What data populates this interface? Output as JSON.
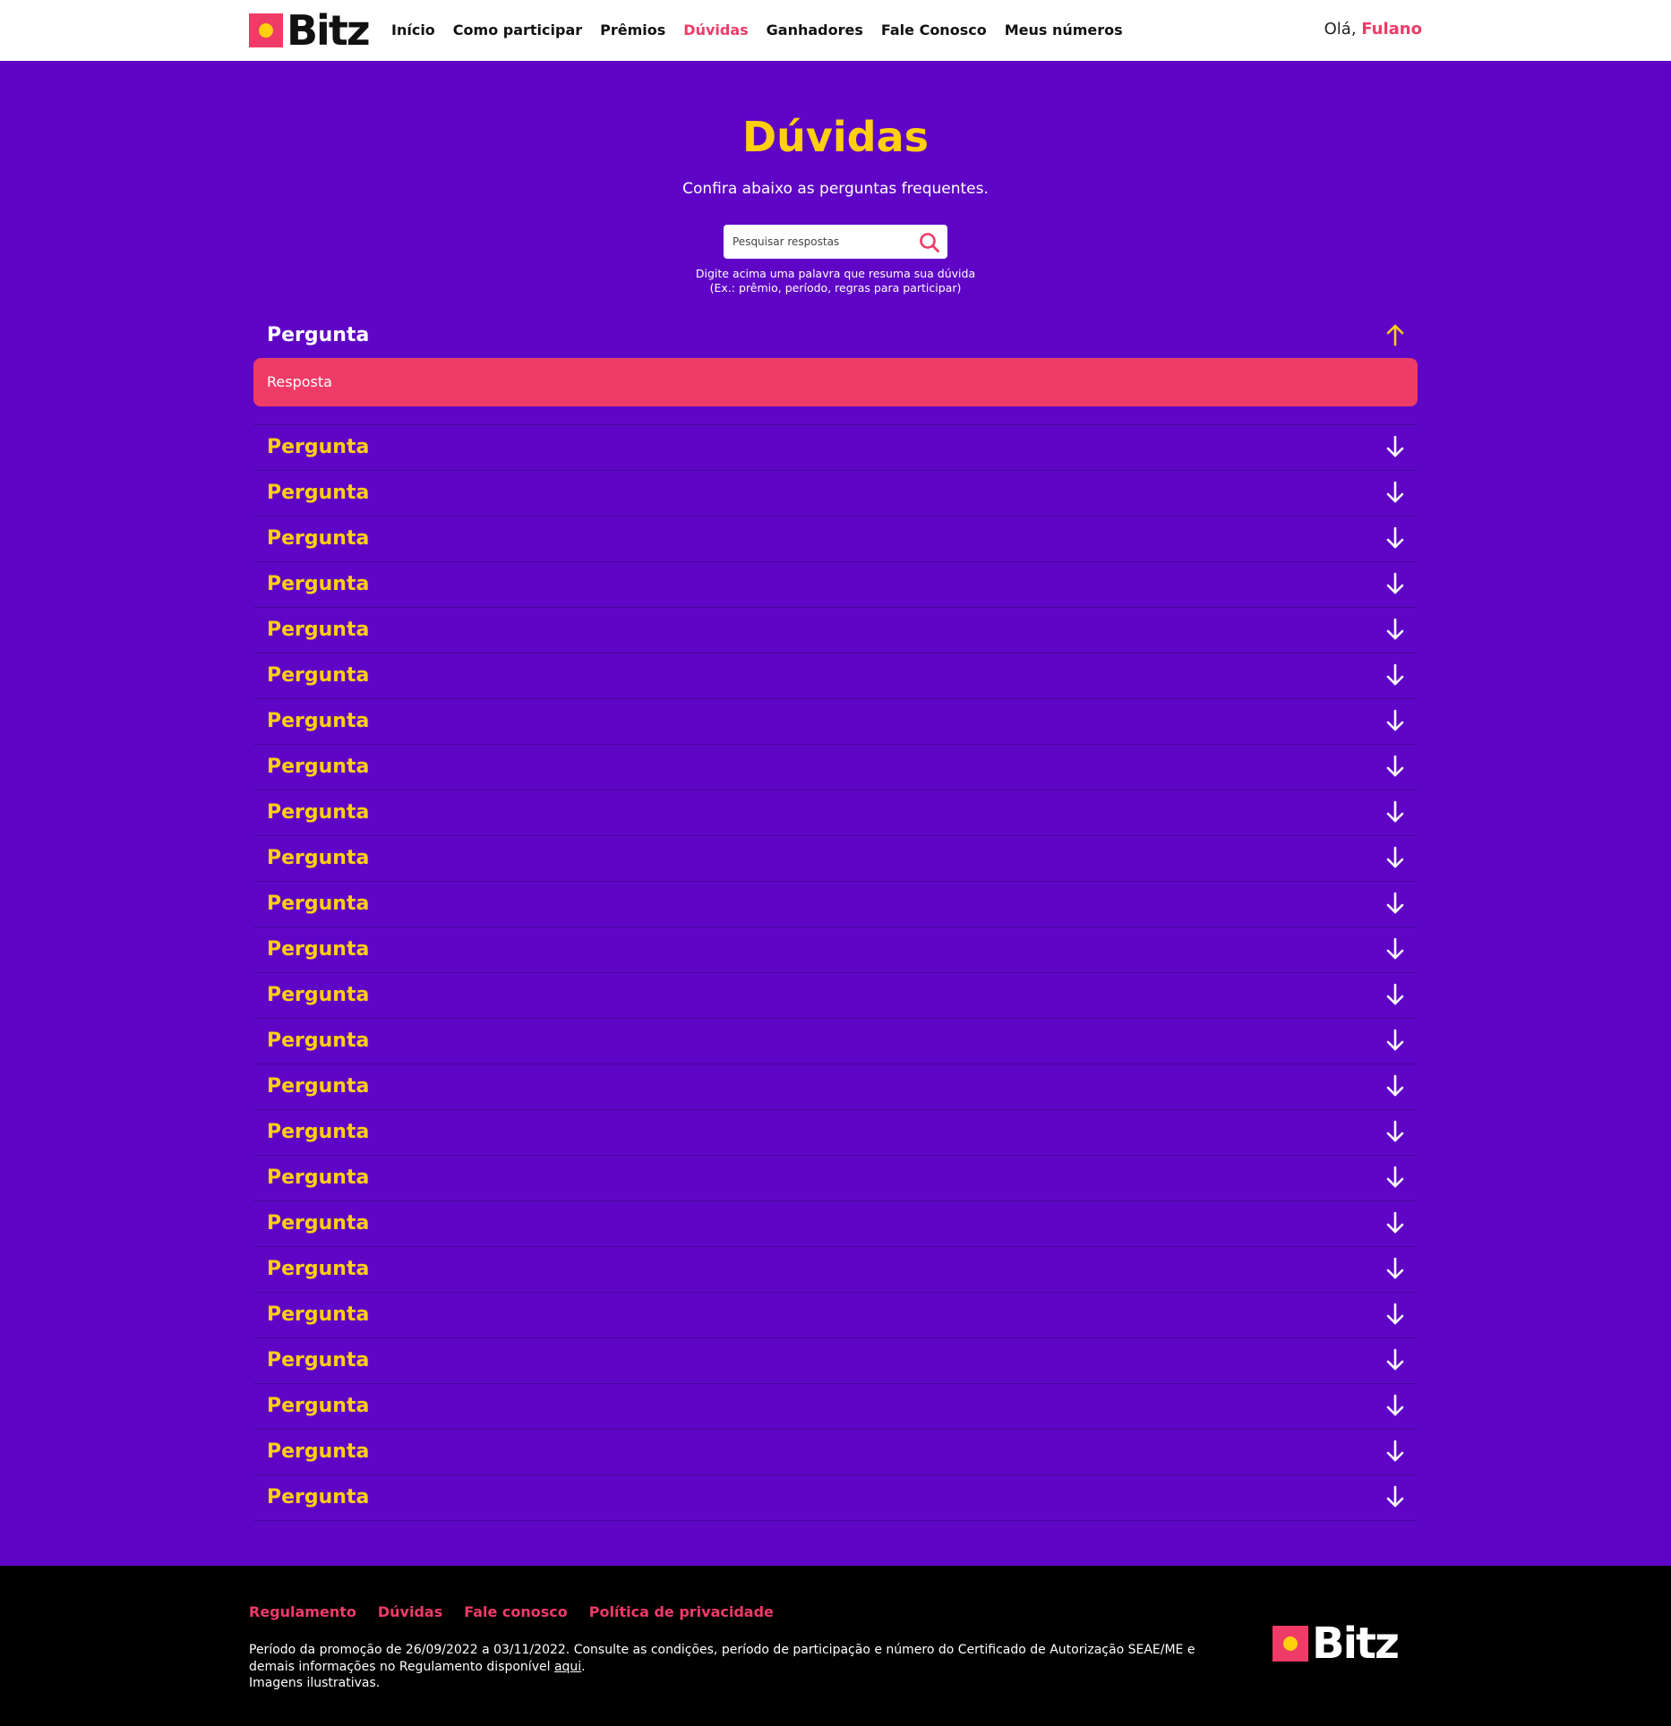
{
  "brand": {
    "name": "Bitz",
    "primary_color": "#ef3b67",
    "accent_color": "#ffcf10",
    "background_color": "#5f06c6"
  },
  "header": {
    "nav": [
      {
        "label": "Início",
        "active": false
      },
      {
        "label": "Como participar",
        "active": false
      },
      {
        "label": "Prêmios",
        "active": false
      },
      {
        "label": "Dúvidas",
        "active": true
      },
      {
        "label": "Ganhadores",
        "active": false
      },
      {
        "label": "Fale Conosco",
        "active": false
      },
      {
        "label": "Meus números",
        "active": false
      }
    ],
    "greeting": "Olá,",
    "user_name": "Fulano"
  },
  "hero": {
    "title": "Dúvidas",
    "subtitle": "Confira abaixo as perguntas frequentes.",
    "search_placeholder": "Pesquisar respostas",
    "hint_line1": "Digite acima uma palavra que resuma sua dúvida",
    "hint_line2": "(Ex.: prêmio, período, regras para participar)"
  },
  "faq": [
    {
      "question": "Pergunta",
      "answer": "Resposta",
      "open": true
    },
    {
      "question": "Pergunta",
      "open": false
    },
    {
      "question": "Pergunta",
      "open": false
    },
    {
      "question": "Pergunta",
      "open": false
    },
    {
      "question": "Pergunta",
      "open": false
    },
    {
      "question": "Pergunta",
      "open": false
    },
    {
      "question": "Pergunta",
      "open": false
    },
    {
      "question": "Pergunta",
      "open": false
    },
    {
      "question": "Pergunta",
      "open": false
    },
    {
      "question": "Pergunta",
      "open": false
    },
    {
      "question": "Pergunta",
      "open": false
    },
    {
      "question": "Pergunta",
      "open": false
    },
    {
      "question": "Pergunta",
      "open": false
    },
    {
      "question": "Pergunta",
      "open": false
    },
    {
      "question": "Pergunta",
      "open": false
    },
    {
      "question": "Pergunta",
      "open": false
    },
    {
      "question": "Pergunta",
      "open": false
    },
    {
      "question": "Pergunta",
      "open": false
    },
    {
      "question": "Pergunta",
      "open": false
    },
    {
      "question": "Pergunta",
      "open": false
    },
    {
      "question": "Pergunta",
      "open": false
    },
    {
      "question": "Pergunta",
      "open": false
    },
    {
      "question": "Pergunta",
      "open": false
    },
    {
      "question": "Pergunta",
      "open": false
    },
    {
      "question": "Pergunta",
      "open": false
    }
  ],
  "footer": {
    "links": [
      "Regulamento",
      "Dúvidas",
      "Fale conosco",
      "Política de privacidade"
    ],
    "text_line1": "Período da promoção de 26/09/2022 a 03/11/2022. Consulte as condições, período de participação e número do Certificado de Autorização SEAE/ME e",
    "text_line2_prefix": "demais informações no Regulamento disponível ",
    "text_line2_link": "aqui",
    "text_line2_suffix": ".",
    "text_line3": "Imagens ilustrativas."
  }
}
